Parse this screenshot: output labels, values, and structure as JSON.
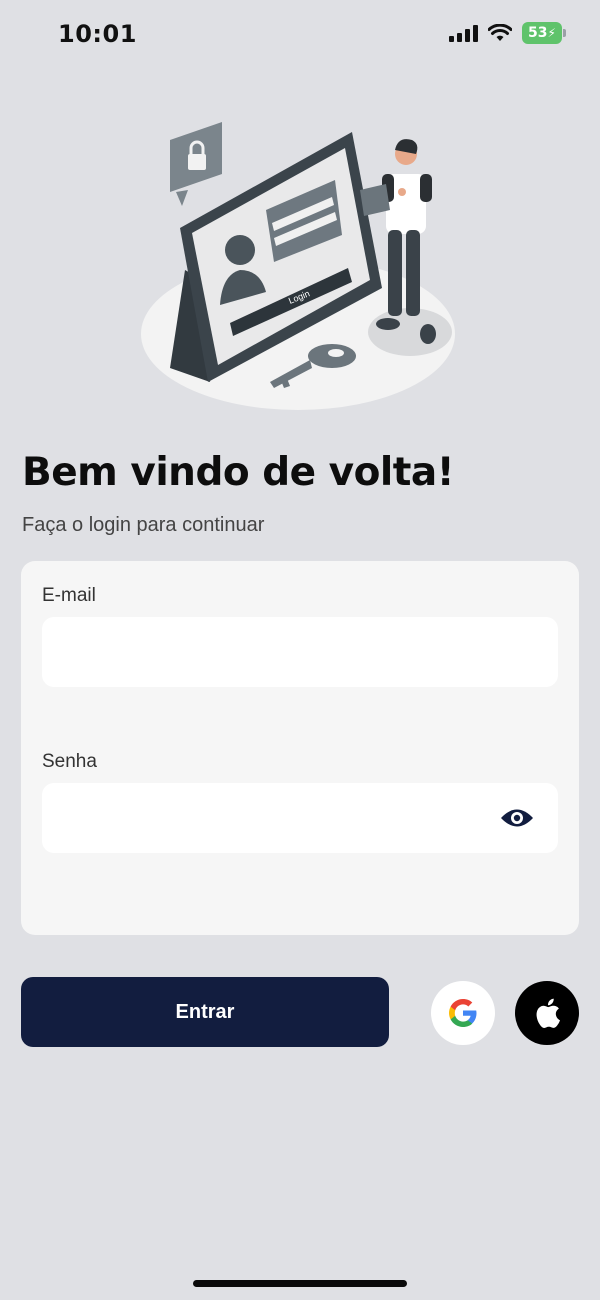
{
  "status_bar": {
    "time": "10:01",
    "battery": "53",
    "icons": [
      "signal-icon",
      "wifi-icon",
      "battery-icon"
    ]
  },
  "illustration": {
    "screen_button_label": "Login",
    "icons": [
      "padlock-icon",
      "key-icon",
      "user-avatar-icon"
    ]
  },
  "header": {
    "title": "Bem vindo de volta!",
    "subtitle": "Faça o login para continuar"
  },
  "form": {
    "email": {
      "label": "E-mail",
      "value": "",
      "placeholder": ""
    },
    "password": {
      "label": "Senha",
      "value": "",
      "placeholder": ""
    }
  },
  "actions": {
    "submit_label": "Entrar",
    "social": [
      "google-icon",
      "apple-icon"
    ]
  },
  "colors": {
    "background": "#dfe0e4",
    "primary": "#121d3f",
    "card": "#f6f6f6",
    "battery": "#5fc36b"
  }
}
